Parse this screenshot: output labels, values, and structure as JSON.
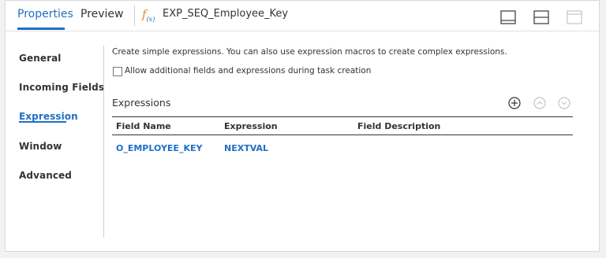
{
  "header": {
    "tabs": [
      {
        "label": "Properties",
        "active": true
      },
      {
        "label": "Preview",
        "active": false
      }
    ],
    "transformation_icon": "expression-fx-icon",
    "transformation_name": "EXP_SEQ_Employee_Key",
    "layout_icons": [
      "panel-bottom-layout-icon",
      "panel-split-layout-icon",
      "panel-top-layout-icon"
    ]
  },
  "nav": {
    "items": [
      {
        "label": "General",
        "active": false
      },
      {
        "label": "Incoming Fields",
        "active": false
      },
      {
        "label": "Expression",
        "active": true
      },
      {
        "label": "Window",
        "active": false
      },
      {
        "label": "Advanced",
        "active": false
      }
    ]
  },
  "content": {
    "description": "Create simple expressions. You can also use expression macros to create complex expressions.",
    "checkbox_label": "Allow additional fields and expressions during task creation",
    "checkbox_checked": false,
    "section_title": "Expressions",
    "actions": [
      "add-circle-icon",
      "move-up-circle-icon",
      "move-down-circle-icon"
    ],
    "table": {
      "columns": [
        "Field Name",
        "Expression",
        "Field Description"
      ],
      "rows": [
        {
          "field_name": "O_EMPLOYEE_KEY",
          "expression": "NEXTVAL",
          "description": ""
        }
      ]
    }
  },
  "colors": {
    "accent": "#1f6fc5",
    "fx_orange": "#e08a1e"
  }
}
